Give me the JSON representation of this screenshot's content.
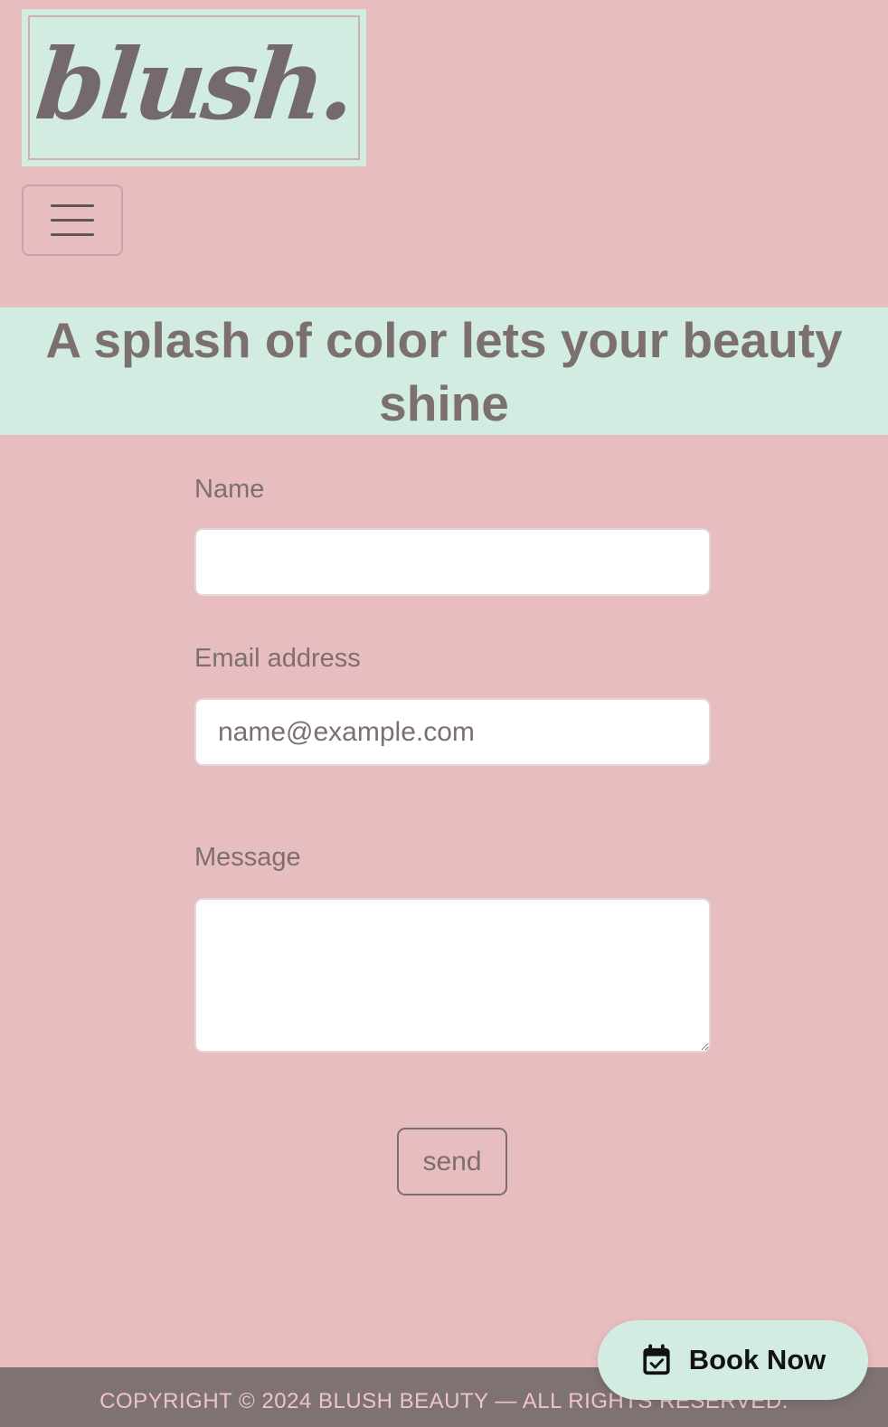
{
  "brand": {
    "logo_text": "blush.",
    "colors": {
      "background": "#e8bdbf",
      "mint": "#d3ece2",
      "text": "#7c6f70",
      "footer_bg": "#7e7273",
      "footer_text": "#f0c4c6"
    }
  },
  "header": {
    "menu_icon": "hamburger-menu-icon"
  },
  "banner": {
    "headline": "A splash of color lets your beauty shine"
  },
  "contact_form": {
    "name_label": "Name",
    "name_value": "",
    "email_label": "Email address",
    "email_placeholder": "name@example.com",
    "message_label": "Message",
    "message_value": "",
    "send_label": "send"
  },
  "floating_cta": {
    "icon": "calendar-check-icon",
    "label": "Book Now"
  },
  "footer": {
    "copyright": "COPYRIGHT © 2024 BLUSH BEAUTY — ALL RIGHTS RESERVED."
  }
}
